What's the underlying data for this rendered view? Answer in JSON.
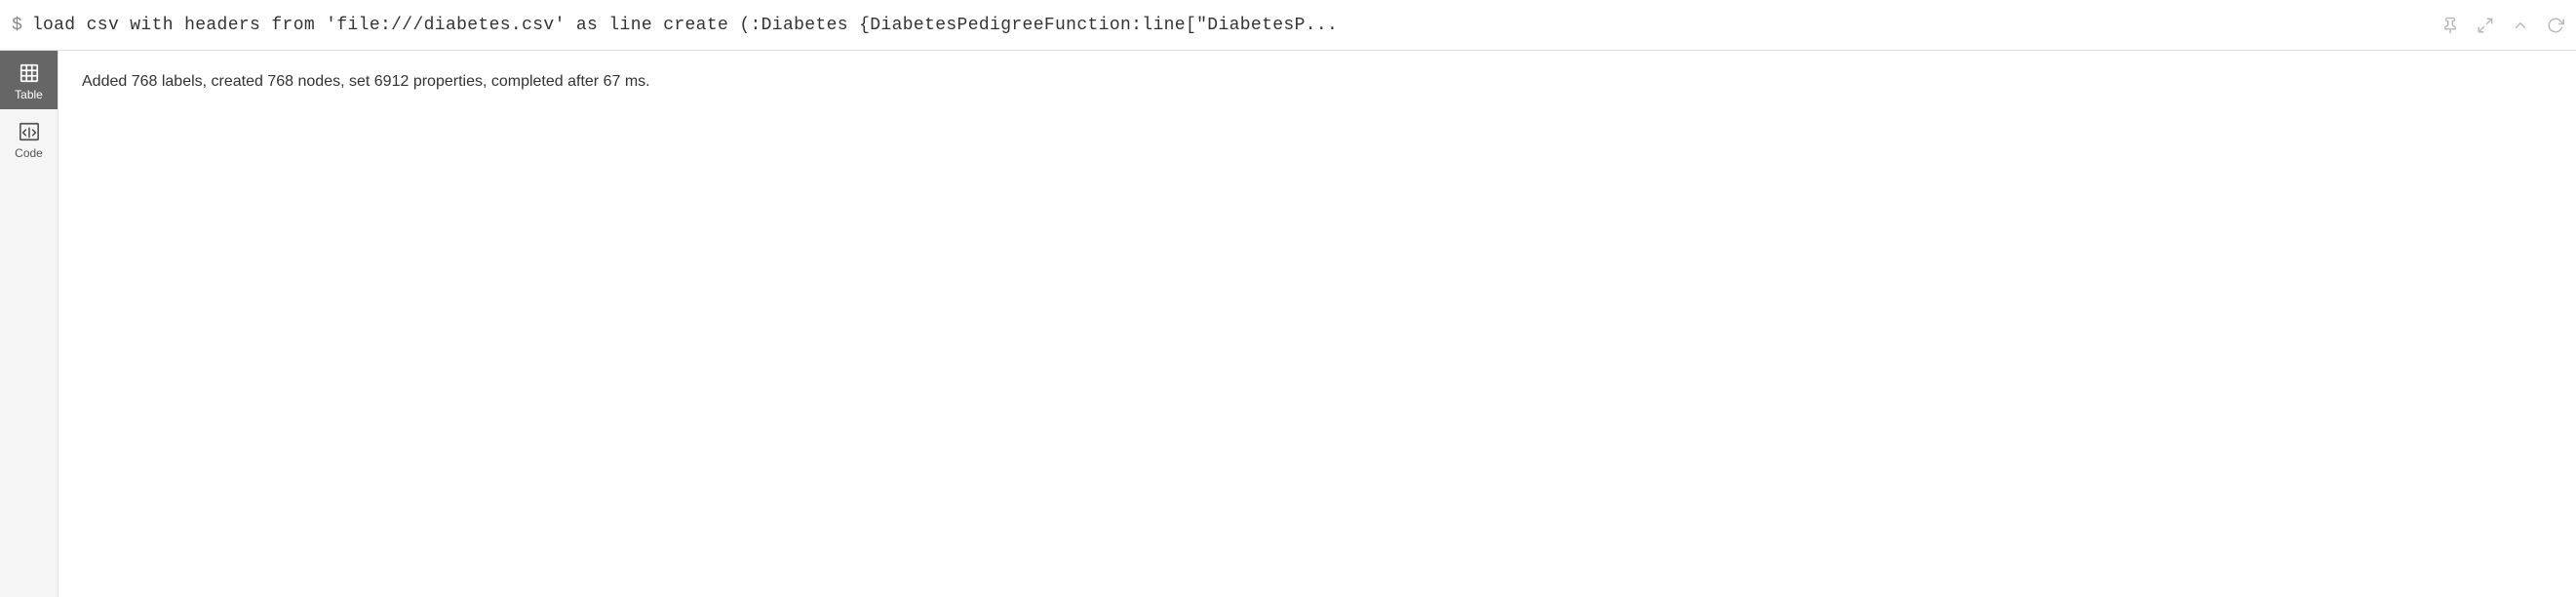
{
  "topbar": {
    "prompt_symbol": "$",
    "command": "load csv with headers from 'file:///diabetes.csv' as line create (:Diabetes {DiabetesPedigreeFunction:line[\"DiabetesP...",
    "pin_icon": "📌",
    "expand_icon": "⤢",
    "chevron_icon": "∧",
    "refresh_icon": "↻"
  },
  "sidebar": {
    "items": [
      {
        "id": "table",
        "label": "Table",
        "active": true
      },
      {
        "id": "code",
        "label": "Code",
        "active": false
      }
    ]
  },
  "content": {
    "result": "Added 768 labels, created 768 nodes, set 6912 properties, completed after 67 ms."
  }
}
